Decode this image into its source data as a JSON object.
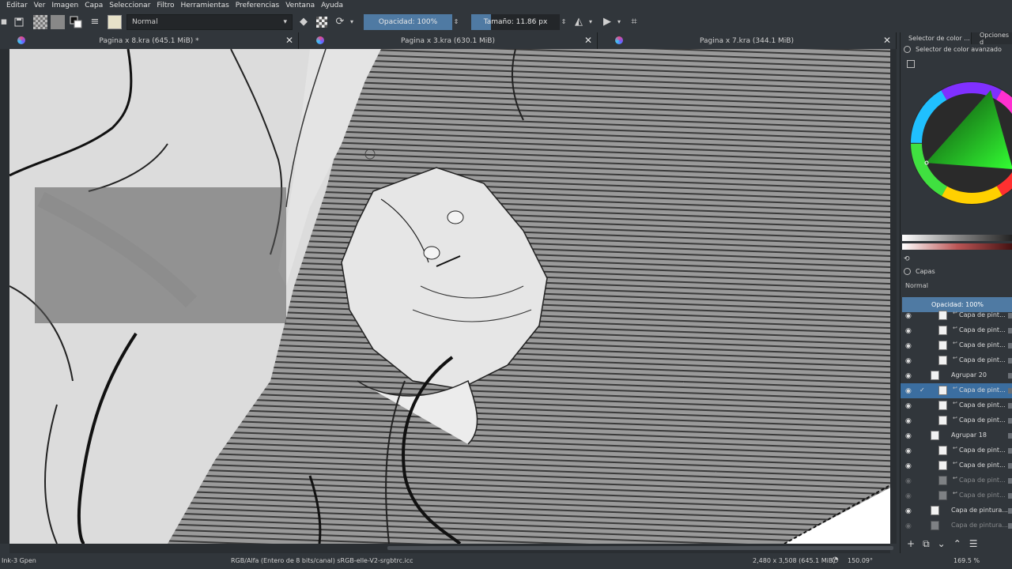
{
  "menubar": {
    "items": [
      "Editar",
      "Ver",
      "Imagen",
      "Capa",
      "Seleccionar",
      "Filtro",
      "Herramientas",
      "Preferencias",
      "Ventana",
      "Ayuda"
    ]
  },
  "toolbar": {
    "blend_mode": "Normal",
    "opacity_label": "Opacidad: 100%",
    "opacity_value": 1.0,
    "size_label": "Tamaño: 11.86 px",
    "size_fill": 0.22
  },
  "tabs": [
    {
      "label": "Pagina x 8.kra (645.1 MiB) *"
    },
    {
      "label": "Pagina x 3.kra (630.1 MiB)"
    },
    {
      "label": "Pagina x 7.kra (344.1 MiB)"
    }
  ],
  "dock": {
    "tab1": "Selector de color ...",
    "tab2": "Opciones d",
    "color_selector_title": "Selector de color avanzado",
    "layers_title": "Capas",
    "layers_blend": "Normal",
    "layers_opacity": "Opacidad:  100%",
    "layers": [
      {
        "name": "Capa de pint...",
        "visible": true,
        "indent": 1,
        "clipped": true,
        "selected": false
      },
      {
        "name": "Capa de pint...",
        "visible": true,
        "indent": 1,
        "clipped": true,
        "selected": false
      },
      {
        "name": "Capa de pint...",
        "visible": true,
        "indent": 1,
        "clipped": true,
        "selected": false
      },
      {
        "name": "Capa de pint...",
        "visible": true,
        "indent": 1,
        "clipped": true,
        "selected": false
      },
      {
        "name": "Agrupar 20",
        "visible": true,
        "indent": 0,
        "clipped": false,
        "selected": false
      },
      {
        "name": "Capa de pint...",
        "visible": true,
        "indent": 1,
        "clipped": true,
        "selected": true
      },
      {
        "name": "Capa de pint...",
        "visible": true,
        "indent": 1,
        "clipped": true,
        "selected": false
      },
      {
        "name": "Capa de pint...",
        "visible": true,
        "indent": 1,
        "clipped": true,
        "selected": false
      },
      {
        "name": "Agrupar 18",
        "visible": true,
        "indent": 0,
        "clipped": false,
        "selected": false
      },
      {
        "name": "Capa de pint...",
        "visible": true,
        "indent": 1,
        "clipped": true,
        "selected": false
      },
      {
        "name": "Capa de pint...",
        "visible": true,
        "indent": 1,
        "clipped": true,
        "selected": false
      },
      {
        "name": "Capa de pint...",
        "visible": false,
        "indent": 1,
        "clipped": true,
        "selected": false
      },
      {
        "name": "Capa de pint...",
        "visible": false,
        "indent": 1,
        "clipped": true,
        "selected": false
      },
      {
        "name": "Capa de pintura...",
        "visible": true,
        "indent": 0,
        "clipped": false,
        "selected": false
      },
      {
        "name": "Capa de pintura...",
        "visible": false,
        "indent": 0,
        "clipped": false,
        "selected": false
      }
    ]
  },
  "status": {
    "brush": "Ink-3 Gpen",
    "color_space": "RGB/Alfa (Entero de 8 bits/canal)  sRGB-elle-V2-srgbtrc.icc",
    "dimensions": "2,480 x 3,508 (645.1 MiB)",
    "rotation": "150.09°",
    "zoom": "169.5 %"
  },
  "icons": [
    "save-icon",
    "pattern-icon",
    "swap-colors-icon",
    "brush-settings-icon",
    "preset-icon",
    "eraser-icon",
    "alpha-lock-icon",
    "reload-icon",
    "mirror-horizontal-icon",
    "mirror-vertical-icon",
    "crop-icon",
    "eye-icon",
    "add-icon",
    "duplicate-icon",
    "move-down-icon",
    "move-up-icon",
    "properties-icon",
    "rotate-icon"
  ]
}
